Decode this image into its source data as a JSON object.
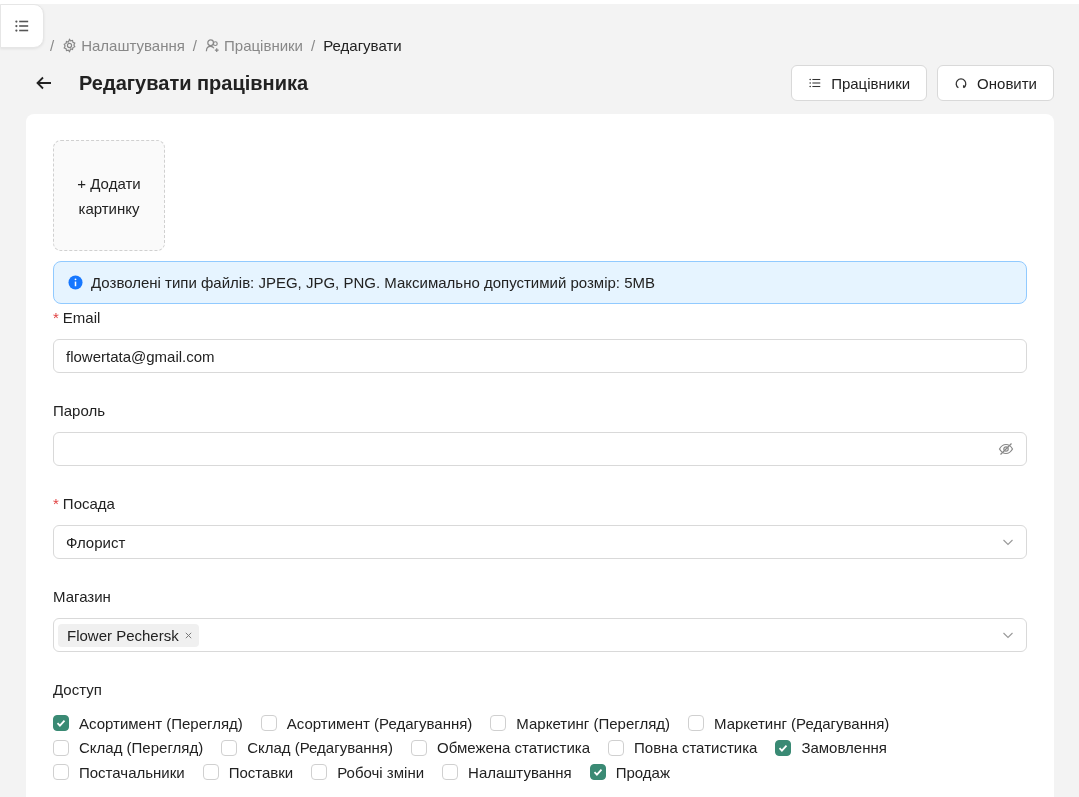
{
  "breadcrumb": [
    {
      "sep": "/",
      "label": "Налаштування",
      "current": false
    },
    {
      "sep": "/",
      "label": "Працівники",
      "current": false
    },
    {
      "sep": "/",
      "label": "Редагувати",
      "current": true
    }
  ],
  "title": "Редагувати працівника",
  "actions": [
    {
      "label": "Працівники"
    },
    {
      "label": "Оновити"
    }
  ],
  "upload": {
    "lines": [
      "+ Додати",
      "картинку"
    ]
  },
  "alert": "Дозволені типи файлів: JPEG, JPG, PNG. Максимально допустимий розмір: 5MB",
  "fields": [
    {
      "kind": "text",
      "label": "Email",
      "marker": "*",
      "value": "flowertata@gmail.com"
    },
    {
      "kind": "password",
      "label": "Пароль"
    },
    {
      "kind": "select",
      "label": "Посада",
      "marker": "*",
      "value": "Флорист"
    },
    {
      "kind": "tags",
      "label": "Магазин",
      "tags": [
        "Flower Pechersk"
      ]
    }
  ],
  "access": {
    "label": "Доступ",
    "items": [
      {
        "label": "Асортимент (Перегляд)",
        "checked": true
      },
      {
        "label": "Асортимент (Редагування)",
        "checked": false
      },
      {
        "label": "Маркетинг (Перегляд)",
        "checked": false
      },
      {
        "label": "Маркетинг (Редагування)",
        "checked": false
      },
      {
        "label": "Склад (Перегляд)",
        "checked": false
      },
      {
        "label": "Склад (Редагування)",
        "checked": false
      },
      {
        "label": "Обмежена статистика",
        "checked": false
      },
      {
        "label": "Повна статистика",
        "checked": false
      },
      {
        "label": "Замовлення",
        "checked": true
      },
      {
        "label": "Постачальники",
        "checked": false
      },
      {
        "label": "Поставки",
        "checked": false
      },
      {
        "label": "Робочі зміни",
        "checked": false
      },
      {
        "label": "Налаштування",
        "checked": false
      },
      {
        "label": "Продаж",
        "checked": true
      }
    ]
  }
}
